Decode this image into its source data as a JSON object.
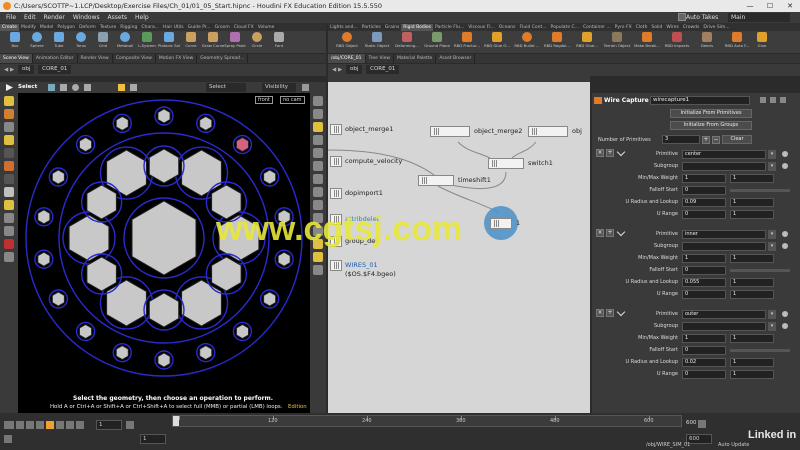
{
  "window": {
    "title": "C:/Users/SCOTTP~1.LCP/Desktop/Exercise Files/Ch_01/01_05_Start.hipnc - Houdini FX Education Edition 15.5.550",
    "minimize": "—",
    "maximize": "☐",
    "close": "✕"
  },
  "menu": {
    "items": [
      "File",
      "Edit",
      "Render",
      "Windows",
      "Assets",
      "Help"
    ],
    "auto_takes": "Auto Takes",
    "desktop": "Main"
  },
  "shelf_left": {
    "tabs": [
      "Create",
      "Modify",
      "Model",
      "Polygon",
      "Deform",
      "Texture",
      "Rigging",
      "Chara...",
      "Hair Utils",
      "Guide Pr...",
      "Groom",
      "Cloud FX",
      "Volume"
    ],
    "tools": [
      "Box",
      "Sphere",
      "Tube",
      "Torus",
      "Grid",
      "Metaball",
      "L-System",
      "Platonic Sol...",
      "Curve",
      "Draw Curve",
      "Spray Paint",
      "Circle",
      "Font"
    ]
  },
  "shelf_right": {
    "tabs": [
      "Lights and...",
      "Particles",
      "Grains",
      "Rigid Bodies",
      "Particle Flu...",
      "Viscous Fl...",
      "Oceans",
      "Fluid Cont...",
      "Populate C...",
      "Container ...",
      "Pyro FX",
      "Cloth",
      "Solid",
      "Wires",
      "Crowds",
      "Drive Sim..."
    ],
    "tools": [
      "RBD Object",
      "Static Object",
      "Deforming...",
      "Ground Plane",
      "RBD Fractur...",
      "RBD Glue O...",
      "RBD Bullet ...",
      "RBD Ragdol...",
      "RBD Glue...",
      "Terrain Object",
      "Make Break...",
      "RBD Impacts",
      "Debris",
      "RBD Auto F...",
      "Glue"
    ]
  },
  "left_pane": {
    "tabs": [
      "Scene View",
      "Animation Editor",
      "Render View",
      "Composite View",
      "Motion FX View",
      "Geometry Spread..."
    ],
    "path_root": "obj",
    "path_node": "CORE_01",
    "select_label": "Select",
    "select_mode": "Select",
    "visibility": "Visibility",
    "camera_front": "front",
    "camera_nocam": "no cam",
    "hint1": "Select the geometry, then choose an operation to perform.",
    "hint2": "Hold A or Ctrl+A or Shift+A or Ctrl+Shift+A to select full (MMB) or partial (LMB) loops.",
    "hint2_link": "Edition"
  },
  "network_pane": {
    "tabs": [
      "/obj/CORE_01",
      "Tree View",
      "Material Palette",
      "Asset Browser"
    ],
    "path_root": "obj",
    "path_node": "CORE_01",
    "nodes": {
      "object_merge1": "object_merge1",
      "object_merge2": "object_merge2",
      "object_merge3": "obj",
      "compute_velocity": "compute_velocity",
      "switch1": "switch1",
      "timeshift1": "timeshift1",
      "dopimport1": "dopimport1",
      "attribdelete1": "attribdelet",
      "group_del": "group_del",
      "wires_01": "WIRES_01",
      "wires_file": "($OS.$F4.bgeo)",
      "wirecapture_tag": "1"
    }
  },
  "params": {
    "node_type": "Wire Capture",
    "node_name": "wirecapture1",
    "init_from_primitives": "Initialize From Primitives",
    "init_from_groups": "Initialize From Groups",
    "num_prims_label": "Number of Primitives",
    "num_prims_value": "3",
    "clear": "Clear",
    "blocks": [
      {
        "primitive": "center",
        "subgroup": "",
        "minmax1": "1",
        "minmax2": "1",
        "falloff": "0",
        "uradius": "0.09",
        "uradius2": "1",
        "urange": "0",
        "urange2": "1"
      },
      {
        "primitive": "inner",
        "subgroup": "",
        "minmax1": "1",
        "minmax2": "1",
        "falloff": "0",
        "uradius": "0.055",
        "uradius2": "1",
        "urange": "0",
        "urange2": "1"
      },
      {
        "primitive": "outer",
        "subgroup": "",
        "minmax1": "1",
        "minmax2": "1",
        "falloff": "0",
        "uradius": "0.02",
        "uradius2": "1",
        "urange": "0",
        "urange2": "1"
      }
    ],
    "labels": {
      "primitive": "Primitive",
      "subgroup": "Subgroup",
      "minmax": "Min/Max Weight",
      "falloff": "Falloff Start",
      "uradius": "U Radius and Lookup",
      "urange": "U Range"
    }
  },
  "timeline": {
    "frame": "1",
    "start": "1",
    "end": "1",
    "ticks": [
      "1",
      "120",
      "240",
      "360",
      "480",
      "600"
    ],
    "end_frame": "600",
    "path": "/obj/WIRE_SIM_01",
    "auto_update": "Auto Update"
  },
  "watermark": "www.cgtsj.com",
  "brand": "Linked in"
}
